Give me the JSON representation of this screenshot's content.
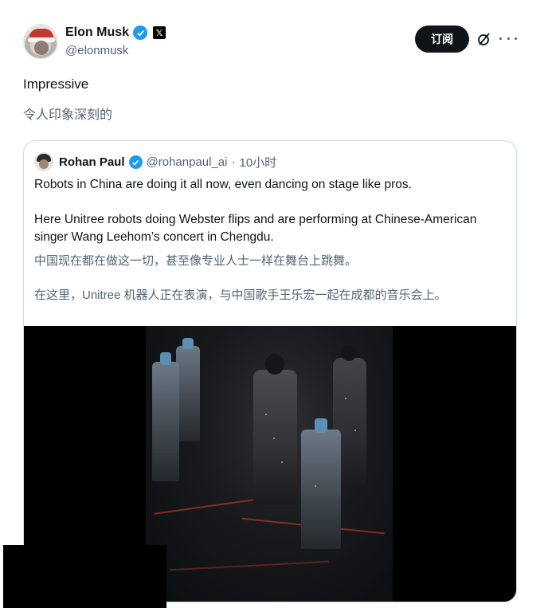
{
  "author": {
    "name": "Elon Musk",
    "handle": "@elonmusk"
  },
  "actions": {
    "subscribe_label": "订阅"
  },
  "post": {
    "text": "Impressive",
    "translation": "令人印象深刻的"
  },
  "quote": {
    "name": "Rohan Paul",
    "handle": "@rohanpaul_ai",
    "separator": "·",
    "time": "10小时",
    "line1": "Robots in China are doing it all now, even dancing on stage like pros.",
    "line2": "Here Unitree robots doing Webster flips and are performing at Chinese-American singer Wang Leehom’s concert in Chengdu.",
    "translation1": "中国现在都在做这一切，甚至像专业人士一样在舞台上跳舞。",
    "translation2": "在这里，Unitree 机器人正在表演，与中国歌手王乐宏一起在成都的音乐会上。"
  },
  "colors": {
    "verified": "#1d9bf0",
    "text_primary": "#0f1419",
    "text_secondary": "#536471",
    "border": "#cfd9de"
  },
  "icons": [
    "verified-badge-icon",
    "x-logo-icon",
    "grok-icon",
    "more-icon"
  ]
}
